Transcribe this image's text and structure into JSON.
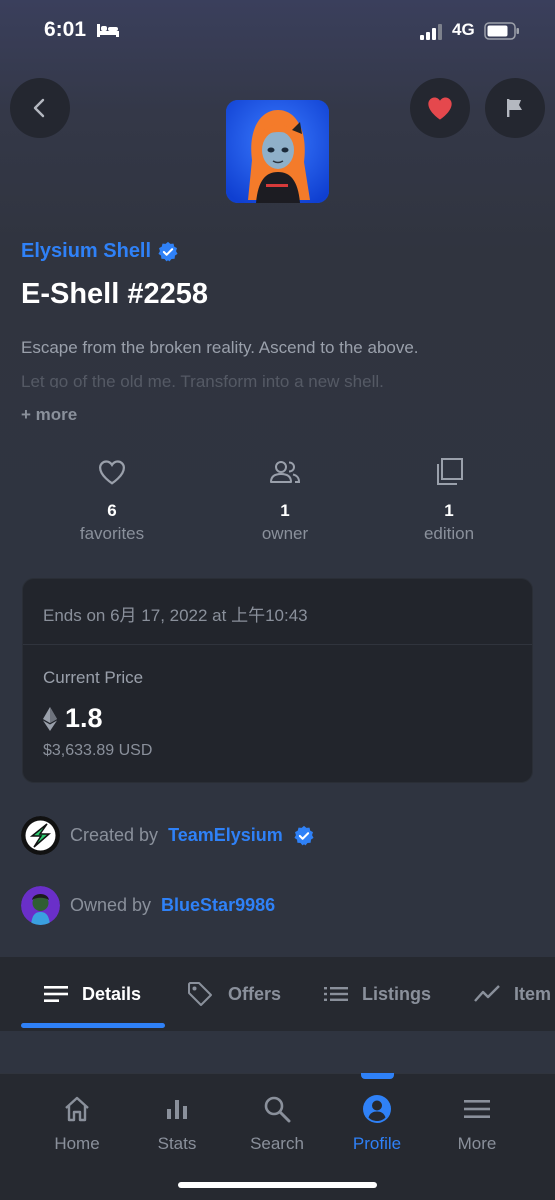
{
  "status_bar": {
    "time": "6:01",
    "network": "4G"
  },
  "header": {
    "back_icon": "chevron-left-icon",
    "favorite_icon": "heart-icon",
    "flag_icon": "flag-icon"
  },
  "nft": {
    "collection": "Elysium Shell",
    "title": "E-Shell #2258",
    "description_line1": "Escape from the broken reality. Ascend to the above.",
    "description_line2": "Let go of the old me. Transform into a new shell.",
    "more_label": "+ more"
  },
  "stats": [
    {
      "value": "6",
      "label": "favorites",
      "icon": "heart-outline-icon"
    },
    {
      "value": "1",
      "label": "owner",
      "icon": "people-icon"
    },
    {
      "value": "1",
      "label": "edition",
      "icon": "copies-icon"
    }
  ],
  "sale": {
    "ends_text": "Ends on 6月 17, 2022 at 上午10:43",
    "current_price_label": "Current Price",
    "price": "1.8",
    "currency_icon": "ethereum-icon",
    "usd": "$3,633.89 USD"
  },
  "creator": {
    "label": "Created by",
    "name": "TeamElysium"
  },
  "owner": {
    "label": "Owned by",
    "name": "BlueStar9986"
  },
  "tabs": [
    {
      "label": "Details",
      "active": true
    },
    {
      "label": "Offers"
    },
    {
      "label": "Listings"
    },
    {
      "label": "Item"
    }
  ],
  "bottom_nav": [
    {
      "label": "Home"
    },
    {
      "label": "Stats"
    },
    {
      "label": "Search"
    },
    {
      "label": "Profile",
      "active": true
    },
    {
      "label": "More"
    }
  ],
  "colors": {
    "accent": "#2f81f7",
    "favorite": "#e5484d",
    "background": "#2f3440"
  }
}
